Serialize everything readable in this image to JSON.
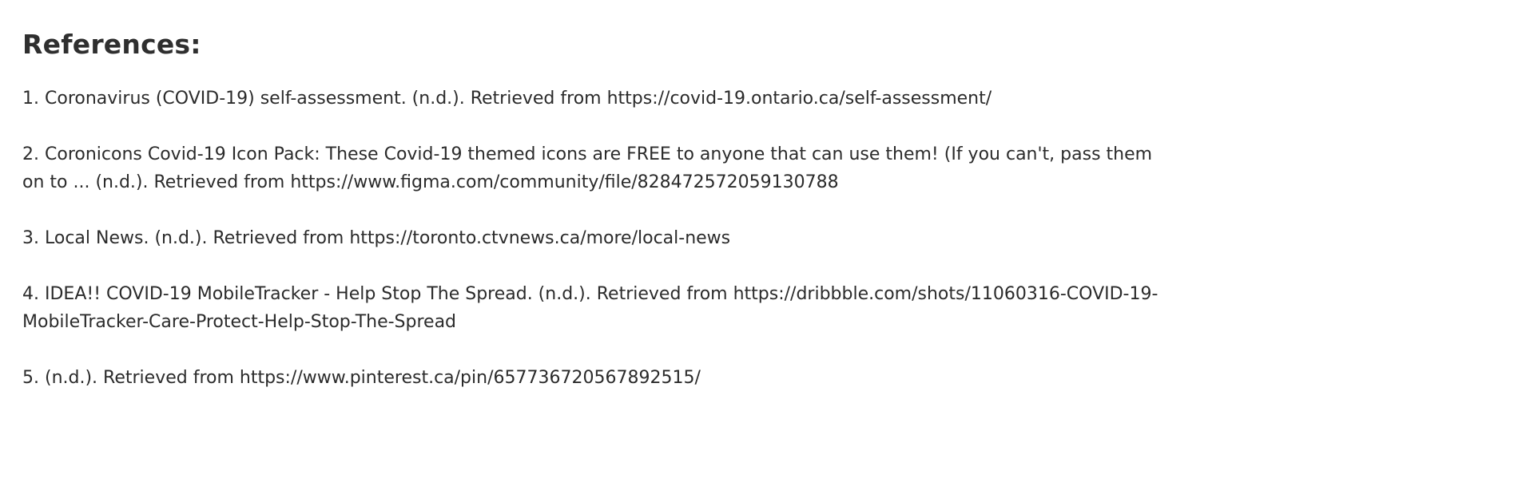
{
  "heading": "References:",
  "references": [
    {
      "number": "1.",
      "text": "Coronavirus (COVID-19) self-assessment. (n.d.). Retrieved from https://covid-19.ontario.ca/self-assessment/"
    },
    {
      "number": "2.",
      "text": "Coronicons Covid-19 Icon Pack: These Covid-19 themed icons are FREE to anyone that can use them! (If you can't, pass them on to ... (n.d.). Retrieved from https://www.figma.com/community/file/828472572059130788"
    },
    {
      "number": "3.",
      "text": "Local News. (n.d.). Retrieved from https://toronto.ctvnews.ca/more/local-news"
    },
    {
      "number": "4.",
      "text": "IDEA!! COVID-19 MobileTracker - Help Stop The Spread. (n.d.). Retrieved from https://dribbble.com/shots/11060316-COVID-19-MobileTracker-Care-Protect-Help-Stop-The-Spread"
    },
    {
      "number": "5.",
      "text": "(n.d.). Retrieved from https://www.pinterest.ca/pin/657736720567892515/"
    }
  ]
}
